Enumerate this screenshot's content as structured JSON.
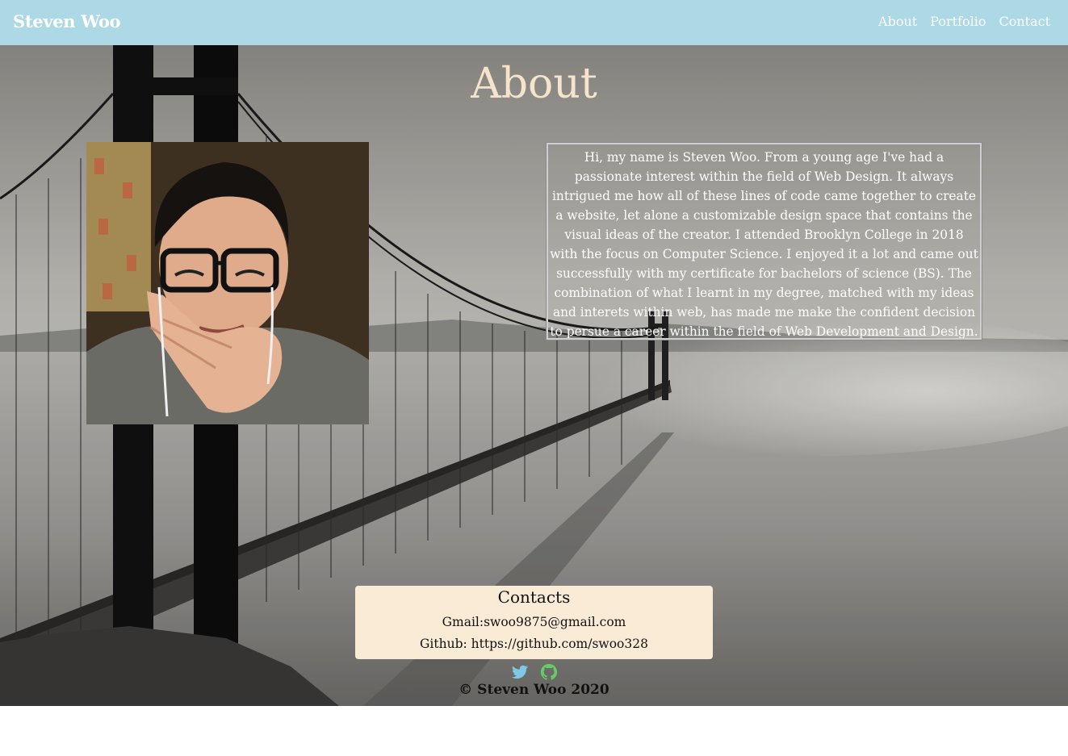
{
  "navbar": {
    "brand": "Steven Woo",
    "links": [
      "About",
      "Portfolio",
      "Contact"
    ]
  },
  "about": {
    "title": "About",
    "bio": "Hi, my name is Steven Woo. From a young age I've had a passionate interest within the field of Web Design. It always intrigued me how all of these lines of code came together to create a website, let alone a customizable design space that contains the visual ideas of the creator. I attended Brooklyn College in 2018 with the focus on Computer Science. I enjoyed it a lot and came out successfully with my certificate for bachelors of science (BS). The combination of what I learnt in my degree, matched with my ideas and interets within web, has made me make the confident decision to persue a career within the field of Web Development and Design."
  },
  "contacts": {
    "title": "Contacts",
    "gmail": "Gmail:swoo9875@gmail.com",
    "github": "Github: https://github.com/swoo328"
  },
  "footer": {
    "icons": [
      "twitter-icon",
      "github-icon"
    ],
    "copyright": "© Steven Woo 2020"
  },
  "colors": {
    "navbar_bg": "#add8e6",
    "title_color": "#f5e3cc",
    "contacts_bg": "#faebd7",
    "twitter": "#7ec8e3",
    "github": "#66cc66"
  }
}
